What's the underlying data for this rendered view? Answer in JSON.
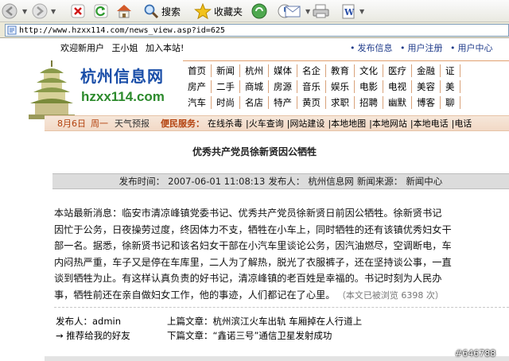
{
  "toolbar": {
    "search_label": "搜索",
    "favorites_label": "收藏夹"
  },
  "address": {
    "url": "http://www.hzxx114.com/news_view.asp?id=625"
  },
  "header": {
    "welcome": "欢迎新用户",
    "username": "王小姐",
    "join": "加入本站!",
    "links": [
      "发布信息",
      "用户注册",
      "用户中心"
    ]
  },
  "logo": {
    "name_cn": "杭州信息网",
    "name_en": "hzxx114.com"
  },
  "nav": {
    "rows": [
      [
        "首页",
        "新闻",
        "杭州",
        "媒体",
        "名企",
        "教育",
        "文化",
        "医疗",
        "金融",
        "证"
      ],
      [
        "房产",
        "二手",
        "商城",
        "房源",
        "音乐",
        "娱乐",
        "电影",
        "电视",
        "美容",
        "美"
      ],
      [
        "汽车",
        "时尚",
        "名店",
        "特产",
        "黄页",
        "求职",
        "招聘",
        "幽默",
        "博客",
        "聊"
      ]
    ]
  },
  "datebar": {
    "date": "8月6日",
    "weekday": "周一",
    "weather": "天气预报",
    "quick_label": "便民服务：",
    "quick_links": [
      "在线杀毒",
      "火车查询",
      "网站建设",
      "本地地图",
      "本地网站",
      "本地电话",
      "电话"
    ]
  },
  "article": {
    "title": "优秀共产党员徐新贤因公牺牲",
    "meta_time_label": "发布时间：",
    "meta_time": "2007-06-01 11:08:13",
    "meta_author_label": "发布人：",
    "meta_author": "杭州信息网",
    "meta_source_label": "新闻来源：",
    "meta_source": "新闻中心",
    "lines": [
      "    本站最新消息：临安市清凉峰镇党委书记、优秀共产党员徐新贤日前因公牺牲。徐新贤书记",
      "因忙于公务，日夜操劳过度，终因体力不支，牺牲在小车上，同时牺牲的还有该镇优秀妇女干",
      "部一名。据悉，徐新贤书记和该名妇女干部在小汽车里谈论公务，因汽油燃尽，空调断电，车",
      "内闷热严重，车子又是停在车库里，二人为了解热，脱光了衣服裤子，还在坚持谈公事，一直",
      "谈到牺牲为止。有这样认真负责的好书记，清凉峰镇的老百姓是幸福的。书记时刻为人民办",
      "事，牺牲前还在亲自做妇女工作，他的事迹，人们都记在了心里。"
    ],
    "views": "（本文已被浏览 6398 次）",
    "publisher_label": "发布人：",
    "publisher": "admin",
    "recommend": "→ 推荐给我的好友",
    "prev_label": "上篇文章：",
    "prev_title": "杭州滨江火车出轨 车厢掉在人行道上",
    "next_label": "下篇文章：",
    "next_title": "“鑫诺三号”通信卫星发射成功"
  },
  "watermark": "#646788",
  "colors": {
    "link_blue": "#1f3b8a",
    "date_orange": "#b3410d",
    "logo_blue": "#1a4ea8",
    "logo_green": "#2c8a2c"
  }
}
